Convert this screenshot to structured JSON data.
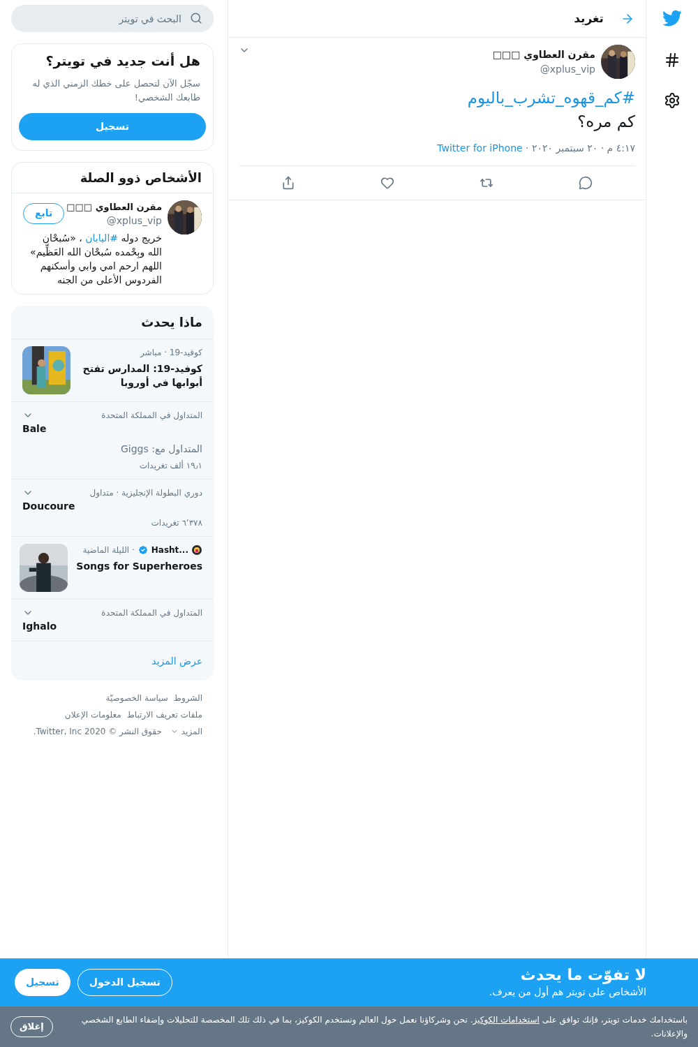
{
  "nav": {
    "items": [
      {
        "kind": "logo"
      },
      {
        "kind": "explore"
      },
      {
        "kind": "settings"
      }
    ]
  },
  "header": {
    "title": "تغريد"
  },
  "tweet": {
    "author": {
      "name": "مقرن العطاوي □□□",
      "handle": "@xplus_vip"
    },
    "hashtag": "#كم_قهوه_تشرب_باليوم",
    "text": "كم مره؟",
    "time": "٤:١٧ م · ٢٠ سبتمبر ٢٠٢٠ · ",
    "source": "Twitter for iPhone",
    "actions": [
      {
        "kind": "reply"
      },
      {
        "kind": "retweet"
      },
      {
        "kind": "like"
      },
      {
        "kind": "share"
      }
    ]
  },
  "search": {
    "placeholder": "البحث في تويتر"
  },
  "signup_card": {
    "title": "هل أنت جديد في تويتر؟",
    "text": "سجّل الآن لتحصل على خطك الزمني الذي له طابعك الشخصي!",
    "button": "تسجيل"
  },
  "people": {
    "title": "الأشخاص ذوو الصلة",
    "person": {
      "name": "مقرن العطاوي □□□",
      "handle": "@xplus_vip",
      "follow": "تابع",
      "bio_before": "خريج دوله ",
      "bio_link": "#اليابان",
      "bio_after": " ، «سُبحْان الله وبِحْمده سُبحْان الله العَظِّيم» اللهم ارحم امي وابي وأسكنهم الفردوس الأعلى من الجنه"
    }
  },
  "trends": {
    "title": "ماذا يحدث",
    "items": [
      {
        "kind": "news",
        "meta": "كوفيد-19 · مباشر",
        "title": "كوفيد-19: المدارس تفتح أبوابها في أوروبا"
      },
      {
        "kind": "trend",
        "meta": "المتداول في المملكة المتحدة",
        "title": "Bale",
        "related": "المتداول مع: Giggs",
        "count": "١٩٫١ ألف تغريدات"
      },
      {
        "kind": "trend",
        "meta": "دوري البطولة الإنجليزية · متداول",
        "title": "Doucoure",
        "count": "٦٬٣٧٨ تغريدات"
      },
      {
        "kind": "moment",
        "source": "Hasht...",
        "verified": true,
        "meta": "· الليلة الماضية",
        "title": "Songs for Superheroes"
      },
      {
        "kind": "trend",
        "meta": "المتداول في المملكة المتحدة",
        "title": "Ighalo"
      }
    ],
    "more": "عرض المزيد"
  },
  "footer": {
    "rows": [
      [
        "الشروط",
        "سياسة الخصوصيّة"
      ],
      [
        "ملفات تعريف الارتباط",
        "معلومات الإعلان"
      ]
    ],
    "more": "المزيد",
    "copyright": "حقوق النشر © 2020 Twitter, Inc."
  },
  "banner": {
    "title": "لا تفوّت ما يحدث",
    "subtitle": "الأشخاص على تويتر هم أول من يعرف.",
    "login": "تسجيل الدخول",
    "signup": "تسجيل"
  },
  "cookie": {
    "before": "باستخدامك خدمات تويتر، فإنك توافق على ",
    "link": "استخدامات الكوكيز",
    "after": ". نحن وشركاؤنا نعمل حول العالم ونستخدم الكوكيز، بما في ذلك تلك المخصصة للتحليلات وإضفاء الطابع الشخصي والإعلانات.",
    "close": "إغلاق"
  }
}
